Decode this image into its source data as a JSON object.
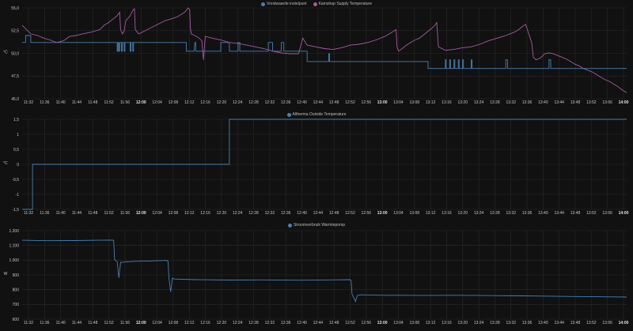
{
  "x_ticks": [
    "11:32",
    "11:36",
    "11:40",
    "11:44",
    "11:48",
    "11:52",
    "11:56",
    "12:00",
    "12:04",
    "12:08",
    "12:12",
    "12:16",
    "12:20",
    "12:24",
    "12:28",
    "12:32",
    "12:36",
    "12:40",
    "12:44",
    "12:48",
    "12:52",
    "12:56",
    "13:00",
    "13:04",
    "13:08",
    "13:12",
    "13:16",
    "13:20",
    "13:24",
    "13:28",
    "13:32",
    "13:36",
    "13:40",
    "13:44",
    "13:48",
    "13:52",
    "13:56",
    "14:00"
  ],
  "x_bold": [
    "12:00",
    "13:00",
    "14:00"
  ],
  "colors": {
    "blue": "#4a7fb0",
    "purple": "#a45ba0",
    "grid": "#2a2a2a",
    "bg": "#111111"
  },
  "chart_data": [
    {
      "type": "line",
      "legend": [
        "Vorstwaarde instelpunt",
        "Kamstrup Supply Temperature"
      ],
      "ylabel": "°C",
      "y_ticks": [
        "55,0",
        "52,5",
        "50,0",
        "47,5",
        "45,0"
      ],
      "ylim": [
        45,
        55.5
      ],
      "x": [
        "11:30",
        "14:00"
      ],
      "series": [
        {
          "name": "Vorstwaarde instelpunt",
          "color": "#4a7fb0",
          "points": [
            [
              0,
              51.5
            ],
            [
              4,
              51.5
            ],
            [
              4,
              52.3
            ],
            [
              10,
              52.3
            ],
            [
              10,
              51.5
            ],
            [
              22,
              51.5
            ],
            [
              22,
              51.5
            ],
            [
              27,
              51.5
            ],
            [
              27,
              51.5
            ],
            [
              60,
              51.5
            ],
            [
              60,
              51.5
            ],
            [
              110,
              51.5
            ],
            [
              110,
              50.5
            ],
            [
              111,
              50.5
            ],
            [
              111,
              51.5
            ],
            [
              112,
              51.5
            ],
            [
              112,
              50.5
            ],
            [
              113,
              50.5
            ],
            [
              113,
              51.5
            ],
            [
              115,
              51.5
            ],
            [
              115,
              50.5
            ],
            [
              116,
              50.5
            ],
            [
              116,
              51.5
            ],
            [
              118,
              51.5
            ],
            [
              118,
              50.5
            ],
            [
              119,
              50.5
            ],
            [
              119,
              51.5
            ],
            [
              125,
              51.5
            ],
            [
              125,
              50.5
            ],
            [
              126,
              50.5
            ],
            [
              126,
              51.5
            ],
            [
              128,
              51.5
            ],
            [
              128,
              50.5
            ],
            [
              129,
              50.5
            ],
            [
              129,
              51.5
            ],
            [
              190,
              51.5
            ],
            [
              190,
              50.5
            ],
            [
              199,
              50.5
            ],
            [
              199,
              50.5
            ],
            [
              200,
              51.5
            ],
            [
              201,
              51.5
            ],
            [
              201,
              50.5
            ],
            [
              230,
              50.5
            ],
            [
              230,
              51.5
            ],
            [
              240,
              51.5
            ],
            [
              240,
              50.5
            ],
            [
              250,
              50.5
            ],
            [
              250,
              51.5
            ],
            [
              252,
              51.5
            ],
            [
              252,
              50.5
            ],
            [
              285,
              50.5
            ],
            [
              285,
              51.5
            ],
            [
              290,
              51.5
            ],
            [
              290,
              50.5
            ],
            [
              300,
              50.5
            ],
            [
              300,
              51.5
            ],
            [
              303,
              51.5
            ],
            [
              303,
              50.5
            ],
            [
              330,
              50.5
            ],
            [
              330,
              49.3
            ],
            [
              355,
              49.3
            ],
            [
              355,
              50.2
            ],
            [
              356,
              50.2
            ],
            [
              356,
              49.3
            ],
            [
              360,
              49.3
            ],
            [
              360,
              49.3
            ],
            [
              470,
              49.3
            ],
            [
              470,
              48.5
            ],
            [
              490,
              48.5
            ],
            [
              490,
              49.5
            ],
            [
              491,
              49.5
            ],
            [
              491,
              48.5
            ],
            [
              495,
              48.5
            ],
            [
              495,
              49.5
            ],
            [
              496,
              49.5
            ],
            [
              496,
              48.5
            ],
            [
              500,
              48.5
            ],
            [
              500,
              49.5
            ],
            [
              501,
              49.5
            ],
            [
              501,
              48.5
            ],
            [
              505,
              48.5
            ],
            [
              505,
              49.5
            ],
            [
              506,
              49.5
            ],
            [
              506,
              48.5
            ],
            [
              510,
              48.5
            ],
            [
              510,
              49.5
            ],
            [
              511,
              49.5
            ],
            [
              511,
              48.5
            ],
            [
              520,
              48.5
            ],
            [
              520,
              49.5
            ],
            [
              521,
              49.5
            ],
            [
              521,
              48.5
            ],
            [
              560,
              48.5
            ],
            [
              560,
              49.5
            ],
            [
              562,
              49.5
            ],
            [
              562,
              48.5
            ],
            [
              610,
              48.5
            ],
            [
              610,
              49.5
            ],
            [
              612,
              49.5
            ],
            [
              612,
              48.5
            ],
            [
              700,
              48.5
            ]
          ]
        },
        {
          "name": "Kamstrup Supply Temperature",
          "color": "#a45ba0",
          "points": [
            [
              0,
              53.5
            ],
            [
              10,
              52.5
            ],
            [
              18,
              52.3
            ],
            [
              25,
              52.0
            ],
            [
              32,
              51.8
            ],
            [
              40,
              51.5
            ],
            [
              48,
              51.7
            ],
            [
              55,
              52.2
            ],
            [
              62,
              52.3
            ],
            [
              70,
              52.5
            ],
            [
              80,
              52.7
            ],
            [
              90,
              53.0
            ],
            [
              95,
              53.5
            ],
            [
              100,
              53.8
            ],
            [
              105,
              54.2
            ],
            [
              110,
              54.6
            ],
            [
              113,
              55.0
            ],
            [
              114,
              53.0
            ],
            [
              116,
              52.5
            ],
            [
              118,
              52.8
            ],
            [
              120,
              54.0
            ],
            [
              125,
              54.6
            ],
            [
              128,
              55.2
            ],
            [
              130,
              55.4
            ],
            [
              131,
              53.0
            ],
            [
              135,
              52.5
            ],
            [
              145,
              53.0
            ],
            [
              155,
              53.5
            ],
            [
              165,
              54.0
            ],
            [
              175,
              54.3
            ],
            [
              180,
              54.5
            ],
            [
              185,
              54.8
            ],
            [
              188,
              55.0
            ],
            [
              190,
              55.2
            ],
            [
              192,
              55.5
            ],
            [
              194,
              55.3
            ],
            [
              195,
              53.0
            ],
            [
              196,
              52.5
            ],
            [
              200,
              52.3
            ],
            [
              205,
              52.0
            ],
            [
              208,
              51.7
            ],
            [
              210,
              49.5
            ],
            [
              212,
              52.2
            ],
            [
              220,
              52.0
            ],
            [
              230,
              51.8
            ],
            [
              240,
              51.5
            ],
            [
              250,
              51.4
            ],
            [
              260,
              51.2
            ],
            [
              270,
              51.0
            ],
            [
              280,
              50.8
            ],
            [
              290,
              50.5
            ],
            [
              300,
              50.3
            ],
            [
              310,
              50.2
            ],
            [
              320,
              50.2
            ],
            [
              325,
              52.0
            ],
            [
              328,
              51.5
            ],
            [
              330,
              51.2
            ],
            [
              340,
              51.0
            ],
            [
              350,
              50.8
            ],
            [
              360,
              50.7
            ],
            [
              370,
              50.9
            ],
            [
              380,
              51.2
            ],
            [
              390,
              51.3
            ],
            [
              400,
              51.5
            ],
            [
              410,
              51.8
            ],
            [
              420,
              52.2
            ],
            [
              425,
              52.5
            ],
            [
              430,
              52.8
            ],
            [
              433,
              53.0
            ],
            [
              434,
              51.0
            ],
            [
              436,
              50.5
            ],
            [
              440,
              50.8
            ],
            [
              445,
              51.2
            ],
            [
              450,
              51.5
            ],
            [
              455,
              51.8
            ],
            [
              460,
              52.0
            ],
            [
              465,
              52.4
            ],
            [
              470,
              52.8
            ],
            [
              475,
              53.2
            ],
            [
              478,
              53.5
            ],
            [
              480,
              53.8
            ],
            [
              482,
              51.0
            ],
            [
              490,
              50.6
            ],
            [
              500,
              50.7
            ],
            [
              510,
              50.9
            ],
            [
              520,
              51.0
            ],
            [
              530,
              51.3
            ],
            [
              540,
              51.7
            ],
            [
              550,
              52.0
            ],
            [
              560,
              52.3
            ],
            [
              570,
              52.7
            ],
            [
              575,
              53.0
            ],
            [
              580,
              53.4
            ],
            [
              583,
              53.6
            ],
            [
              585,
              53.0
            ],
            [
              590,
              51.5
            ],
            [
              592,
              49.8
            ],
            [
              595,
              49.5
            ],
            [
              600,
              49.7
            ],
            [
              605,
              50.2
            ],
            [
              610,
              50.3
            ],
            [
              615,
              50.2
            ],
            [
              620,
              50.0
            ],
            [
              625,
              49.8
            ],
            [
              630,
              49.6
            ],
            [
              635,
              49.3
            ],
            [
              640,
              49.0
            ],
            [
              645,
              48.8
            ],
            [
              650,
              48.5
            ],
            [
              655,
              48.3
            ],
            [
              660,
              48.1
            ],
            [
              665,
              47.8
            ],
            [
              670,
              47.5
            ],
            [
              675,
              47.2
            ],
            [
              680,
              47.0
            ],
            [
              685,
              46.7
            ],
            [
              690,
              46.4
            ],
            [
              695,
              46.0
            ],
            [
              700,
              45.7
            ]
          ]
        }
      ]
    },
    {
      "type": "line",
      "legend": [
        "Altherma Outside Temperature"
      ],
      "ylabel": "°C",
      "y_ticks": [
        "1,5",
        "1",
        "0,5",
        "0",
        "-0,5",
        "-1",
        "-1,5"
      ],
      "ylim": [
        -1.5,
        1.5
      ],
      "series": [
        {
          "name": "Altherma Outside Temperature",
          "color": "#4a7fb0",
          "points": [
            [
              0,
              -1.5
            ],
            [
              12,
              -1.5
            ],
            [
              12,
              0
            ],
            [
              240,
              0
            ],
            [
              240,
              1.5
            ],
            [
              700,
              1.5
            ]
          ]
        }
      ]
    },
    {
      "type": "line",
      "legend": [
        "Stroomverbruik Warmtepomp"
      ],
      "ylabel": "W",
      "y_ticks": [
        "1.200",
        "1.100",
        "1.000",
        "900",
        "800",
        "700",
        "600"
      ],
      "ylim": [
        600,
        1200
      ],
      "series": [
        {
          "name": "Stroomverbruik Warmtepomp",
          "color": "#4a7fb0",
          "points": [
            [
              0,
              1135
            ],
            [
              30,
              1132
            ],
            [
              60,
              1133
            ],
            [
              90,
              1135
            ],
            [
              105,
              1136
            ],
            [
              106,
              1133
            ],
            [
              107,
              1005
            ],
            [
              110,
              990
            ],
            [
              112,
              880
            ],
            [
              114,
              985
            ],
            [
              130,
              992
            ],
            [
              150,
              995
            ],
            [
              160,
              997
            ],
            [
              168,
              998
            ],
            [
              169,
              990
            ],
            [
              170,
              880
            ],
            [
              172,
              785
            ],
            [
              174,
              878
            ],
            [
              176,
              872
            ],
            [
              200,
              868
            ],
            [
              240,
              865
            ],
            [
              280,
              866
            ],
            [
              320,
              864
            ],
            [
              360,
              866
            ],
            [
              380,
              868
            ],
            [
              381,
              860
            ],
            [
              382,
              770
            ],
            [
              386,
              720
            ],
            [
              388,
              760
            ],
            [
              392,
              765
            ],
            [
              420,
              762
            ],
            [
              460,
              761
            ],
            [
              500,
              762
            ],
            [
              540,
              760
            ],
            [
              580,
              758
            ],
            [
              620,
              755
            ],
            [
              660,
              752
            ],
            [
              700,
              750
            ]
          ]
        }
      ]
    }
  ]
}
